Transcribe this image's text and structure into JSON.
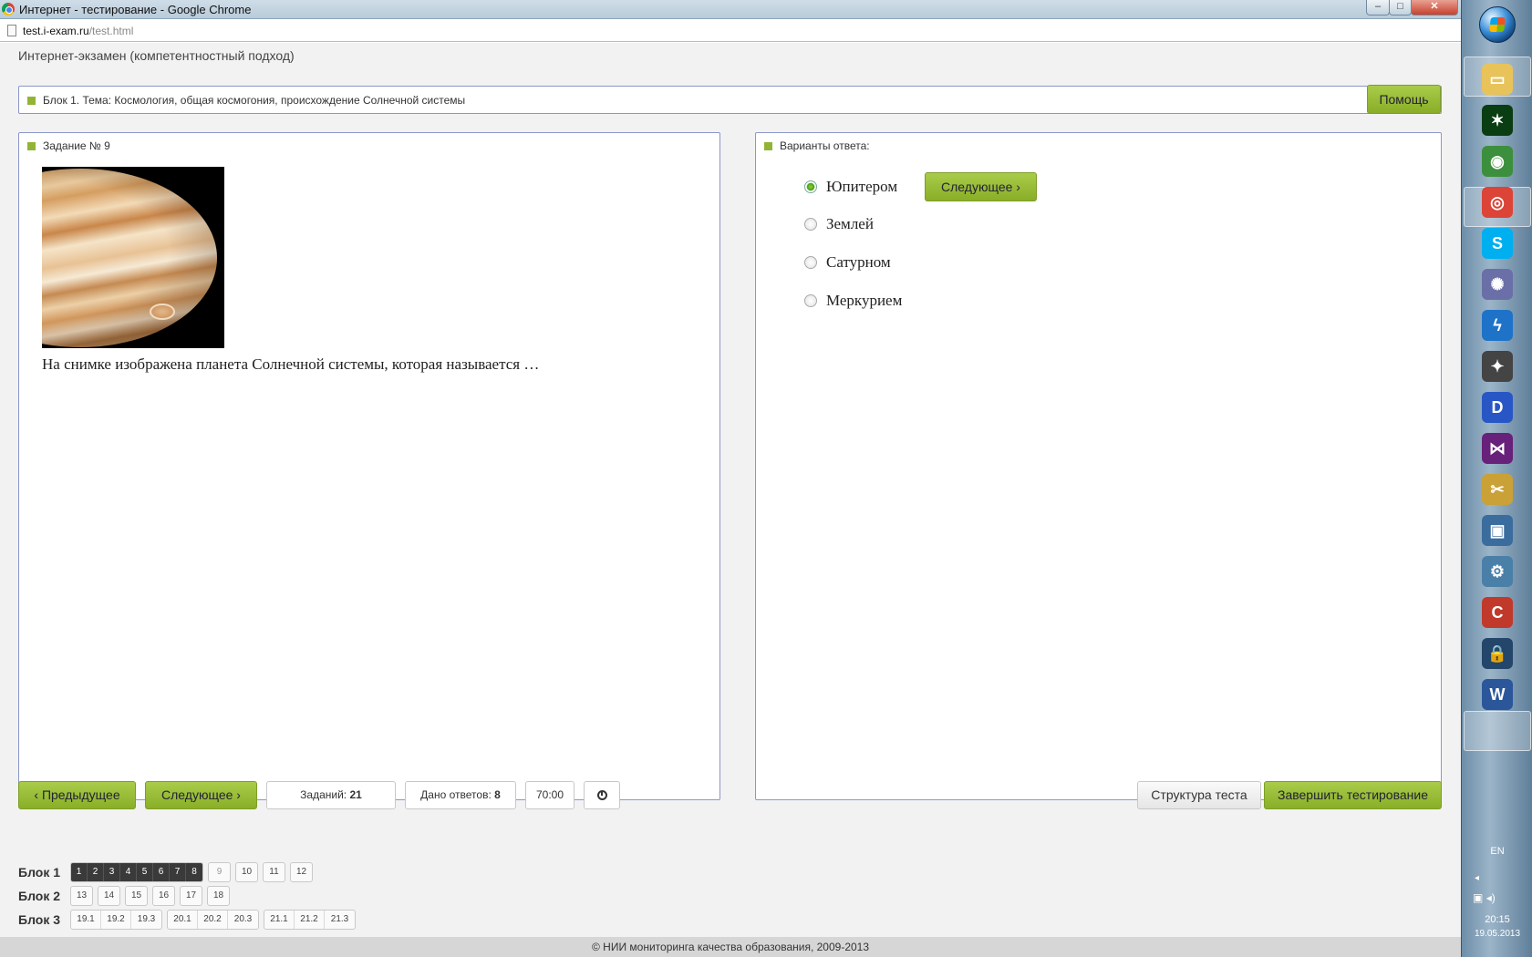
{
  "window": {
    "title": "Интернет - тестирование - Google Chrome",
    "minimize_glyph": "–",
    "maximize_glyph": "□",
    "close_glyph": "✕"
  },
  "address": {
    "host": "test.i-exam.ru",
    "path": "/test.html"
  },
  "app": {
    "header": "Интернет-экзамен (компетентностный подход)"
  },
  "topic": {
    "text": "Блок 1. Тема: Космология, общая космогония, происхождение Солнечной системы",
    "help_label": "Помощь"
  },
  "task": {
    "title": "Задание № 9",
    "image_icon": "planet-jupiter-photo",
    "question": "На снимке изображена планета Солнечной системы, которая называется …"
  },
  "answers": {
    "title": "Варианты ответа:",
    "options": [
      {
        "label": "Юпитером",
        "selected": true
      },
      {
        "label": "Землей",
        "selected": false
      },
      {
        "label": "Сатурном",
        "selected": false
      },
      {
        "label": "Меркурием",
        "selected": false
      }
    ],
    "next_label": "Следующее"
  },
  "toolbar": {
    "prev_label": "Предыдущее",
    "next_label": "Следующее",
    "tasks_label": "Заданий:",
    "tasks_value": "21",
    "answered_label": "Дано ответов:",
    "answered_value": "8",
    "timer": "70:00",
    "clock_icon": "clock-icon",
    "structure_label": "Структура теста",
    "finish_label": "Завершить тестирование"
  },
  "blocks": [
    {
      "label": "Блок 1",
      "groups": [
        [
          "1",
          "2",
          "3",
          "4",
          "5",
          "6",
          "7",
          "8"
        ],
        [
          "9"
        ],
        [
          "10"
        ],
        [
          "11"
        ],
        [
          "12"
        ]
      ]
    },
    {
      "label": "Блок 2",
      "groups": [
        [
          "13"
        ],
        [
          "14"
        ],
        [
          "15"
        ],
        [
          "16"
        ],
        [
          "17"
        ],
        [
          "18"
        ]
      ]
    },
    {
      "label": "Блок 3",
      "groups": [
        [
          "19.1",
          "19.2",
          "19.3"
        ],
        [
          "20.1",
          "20.2",
          "20.3"
        ],
        [
          "21.1",
          "21.2",
          "21.3"
        ]
      ]
    }
  ],
  "answered_questions": [
    "1",
    "2",
    "3",
    "4",
    "5",
    "6",
    "7",
    "8"
  ],
  "current_question": "9",
  "footer": "© НИИ мониторинга качества образования, 2009-2013",
  "taskbar": {
    "lang": "EN",
    "time": "20:15",
    "date": "19.05.2013",
    "icons": [
      "folder-icon",
      "matrix-app-icon",
      "network-globe-icon",
      "chrome-icon",
      "skype-icon",
      "media-app-icon",
      "flash-icon",
      "foxit-icon",
      "daemon-tools-icon",
      "visual-studio-icon",
      "tools-icon",
      "monitor-shield-icon",
      "settings-shield-icon",
      "ccleaner-icon",
      "lock-icon",
      "word-icon"
    ]
  },
  "colors": {
    "accent_green": "#92b436",
    "panel_border": "#8b97c9",
    "answered_cell": "#3a3a3a"
  }
}
